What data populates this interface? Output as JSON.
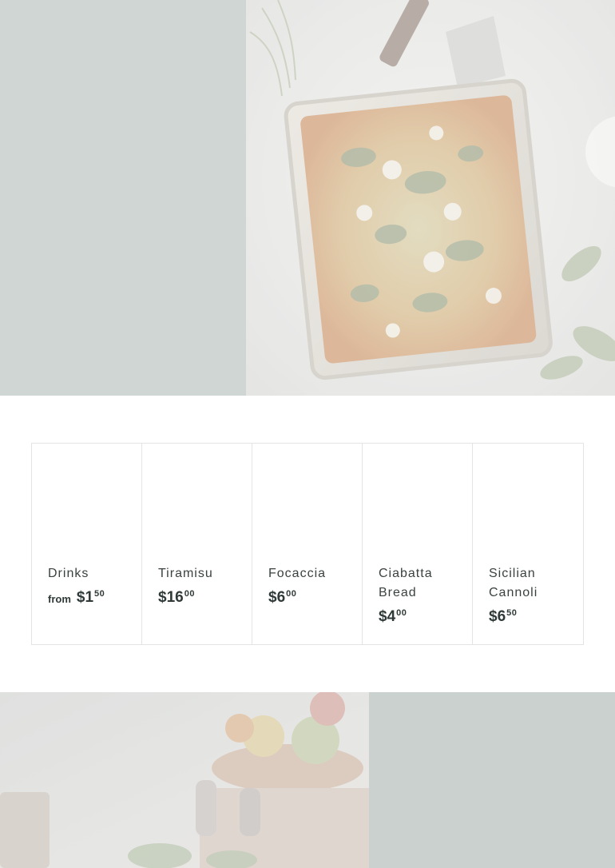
{
  "products": [
    {
      "title": "Drinks",
      "price_prefix": "from",
      "price_whole": "$1",
      "price_cents": "50"
    },
    {
      "title": "Tiramisu",
      "price_prefix": "",
      "price_whole": "$16",
      "price_cents": "00"
    },
    {
      "title": "Focaccia",
      "price_prefix": "",
      "price_whole": "$6",
      "price_cents": "00"
    },
    {
      "title": "Ciabatta Bread",
      "price_prefix": "",
      "price_whole": "$4",
      "price_cents": "00"
    },
    {
      "title": "Sicilian Cannoli",
      "price_prefix": "",
      "price_whole": "$6",
      "price_cents": "50"
    }
  ],
  "colors": {
    "panel_top": "#cfd6d3",
    "panel_bottom": "#cbd1ce",
    "border": "#e4e4e4",
    "text": "#2f3a38"
  }
}
